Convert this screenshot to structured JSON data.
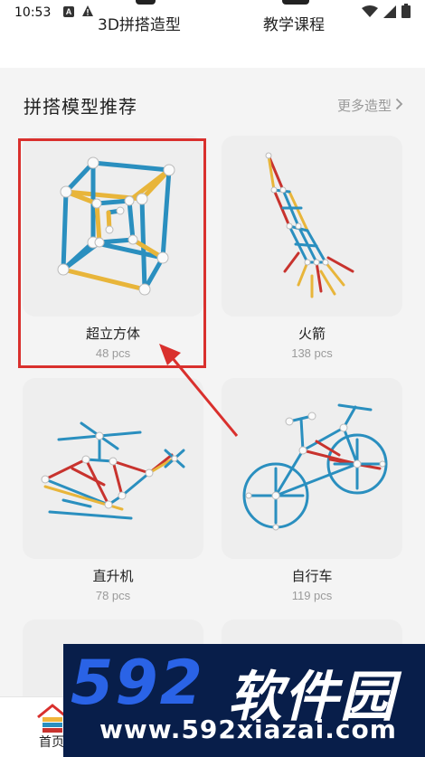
{
  "status_bar": {
    "time": "10:53",
    "app_badge": "A"
  },
  "top_tabs": [
    {
      "label": "3D拼搭造型"
    },
    {
      "label": "教学课程"
    }
  ],
  "section": {
    "title": "拼搭模型推荐",
    "more_label": "更多造型"
  },
  "cards": [
    {
      "name": "超立方体",
      "pcs": "48 pcs",
      "icon": "tesseract-model"
    },
    {
      "name": "火箭",
      "pcs": "138 pcs",
      "icon": "rocket-model"
    },
    {
      "name": "直升机",
      "pcs": "78 pcs",
      "icon": "helicopter-model"
    },
    {
      "name": "自行车",
      "pcs": "119 pcs",
      "icon": "bicycle-model"
    }
  ],
  "bottom_nav": {
    "home_label": "首页"
  },
  "watermark": {
    "logo": "592",
    "brand": "软件园",
    "url": "www.592xiazai.com"
  },
  "colors": {
    "rod_blue": "#2a8fbf",
    "rod_yellow": "#e8b53a",
    "rod_red": "#c8332e",
    "highlight": "#d9302d"
  }
}
